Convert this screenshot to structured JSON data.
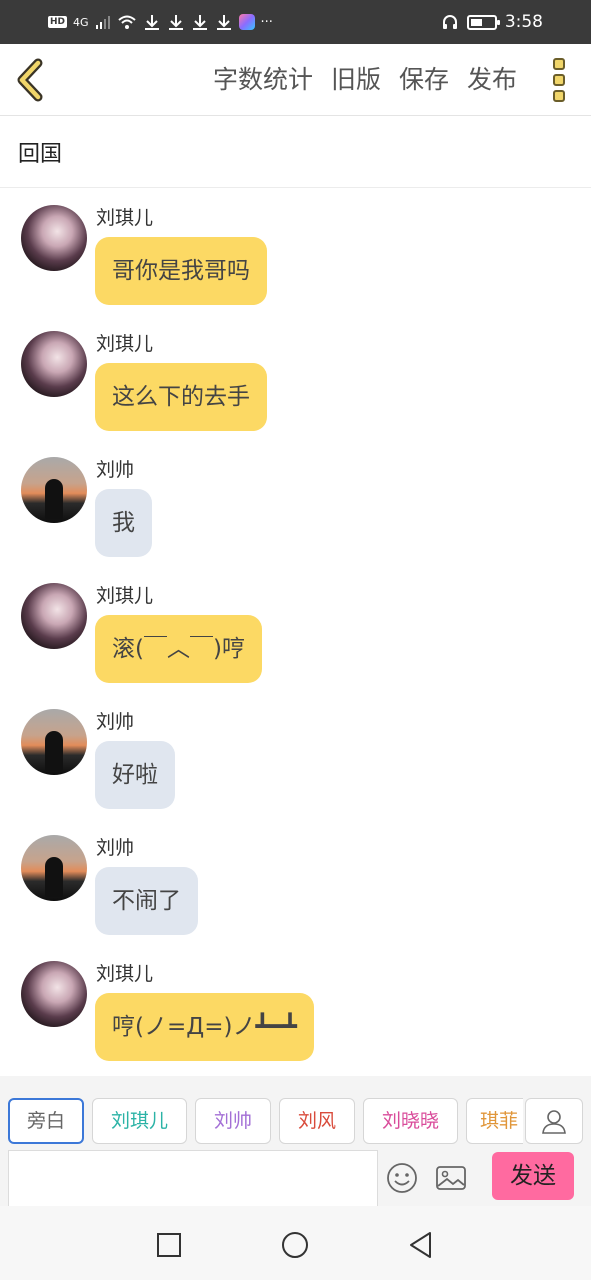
{
  "status_bar": {
    "network": "4G",
    "time": "3:58",
    "battery_level": 0.5
  },
  "toolbar": {
    "actions": [
      "字数统计",
      "旧版",
      "保存",
      "发布"
    ]
  },
  "title": "回国",
  "messages": [
    {
      "sender": "刘琪儿",
      "text": "哥你是我哥吗",
      "style": "yellow",
      "avatar": "qier"
    },
    {
      "sender": "刘琪儿",
      "text": "这么下的去手",
      "style": "yellow",
      "avatar": "qier"
    },
    {
      "sender": "刘帅",
      "text": "我",
      "style": "gray",
      "avatar": "shuai"
    },
    {
      "sender": "刘琪儿",
      "text": "滚(￣︿￣)哼",
      "style": "yellow",
      "avatar": "qier"
    },
    {
      "sender": "刘帅",
      "text": "好啦",
      "style": "gray",
      "avatar": "shuai"
    },
    {
      "sender": "刘帅",
      "text": "不闹了",
      "style": "gray",
      "avatar": "shuai"
    },
    {
      "sender": "刘琪儿",
      "text": "哼(ノ=Д=)ノ┻━┻",
      "style": "yellow",
      "avatar": "qier"
    }
  ],
  "roles": [
    {
      "label": "旁白",
      "color": "#666666",
      "active": true
    },
    {
      "label": "刘琪儿",
      "color": "#2bb3a6",
      "active": false
    },
    {
      "label": "刘帅",
      "color": "#a36fd6",
      "active": false
    },
    {
      "label": "刘风",
      "color": "#d94b3b",
      "active": false
    },
    {
      "label": "刘晓晓",
      "color": "#d94b9a",
      "active": false
    },
    {
      "label": "琪菲",
      "color": "#e0963a",
      "active": false
    }
  ],
  "composer": {
    "input_value": "",
    "send_label": "发送"
  },
  "colors": {
    "accent_yellow": "#fcd964",
    "bubble_gray": "#e0e6ef",
    "send_pink": "#ff6aa0"
  }
}
